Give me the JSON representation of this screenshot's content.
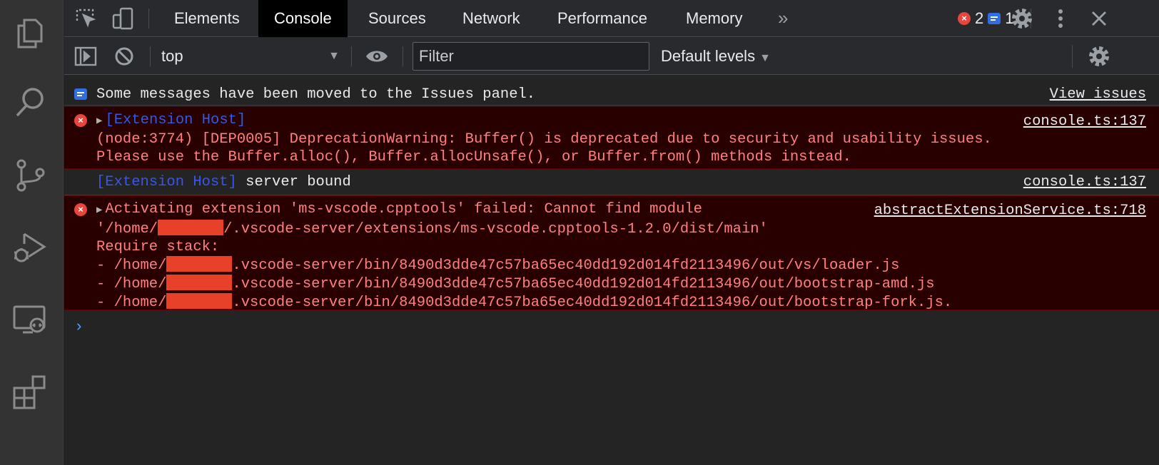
{
  "activity_bar": {
    "items": [
      "explorer-icon",
      "search-icon",
      "source-control-icon",
      "run-debug-icon",
      "remote-explorer-icon",
      "extensions-icon"
    ]
  },
  "tabs": {
    "items": [
      "Elements",
      "Console",
      "Sources",
      "Network",
      "Performance",
      "Memory"
    ],
    "active": "Console",
    "more": "»"
  },
  "badges": {
    "errors": "2",
    "issues": "1"
  },
  "toolbar": {
    "context": "top",
    "filter_placeholder": "Filter",
    "levels": "Default levels"
  },
  "messages": {
    "info": {
      "text": "Some messages have been moved to the Issues panel.",
      "link": "View issues"
    },
    "err1": {
      "tag": "[Extension Host]",
      "line1": "(node:3774) [DEP0005] DeprecationWarning: Buffer() is deprecated due to security and usability issues.",
      "line2": "Please use the Buffer.alloc(), Buffer.allocUnsafe(), or Buffer.from() methods instead.",
      "source": "console.ts:137"
    },
    "log1": {
      "tag": "[Extension Host]",
      "text": " server bound",
      "source": "console.ts:137"
    },
    "err2": {
      "line1": "Activating extension 'ms-vscode.cpptools' failed: Cannot find module",
      "line2_pre": "'/home/",
      "line2_post": "/.vscode-server/extensions/ms-vscode.cpptools-1.2.0/dist/main'",
      "line3": "Require stack:",
      "stack_pre": "- /home/",
      "stack1_post": ".vscode-server/bin/8490d3dde47c57ba65ec40dd192d014fd2113496/out/vs/loader.js",
      "stack2_post": ".vscode-server/bin/8490d3dde47c57ba65ec40dd192d014fd2113496/out/bootstrap-amd.js",
      "stack3_post": ".vscode-server/bin/8490d3dde47c57ba65ec40dd192d014fd2113496/out/bootstrap-fork.js.",
      "source": "abstractExtensionService.ts:718"
    }
  },
  "prompt": "›",
  "colors": {
    "activity_bg": "#333333",
    "panel_bg": "#242424",
    "error_bg": "#290000",
    "error_text": "#ff8080",
    "extension_tag": "#3757e7",
    "redaction": "#e8412a"
  }
}
